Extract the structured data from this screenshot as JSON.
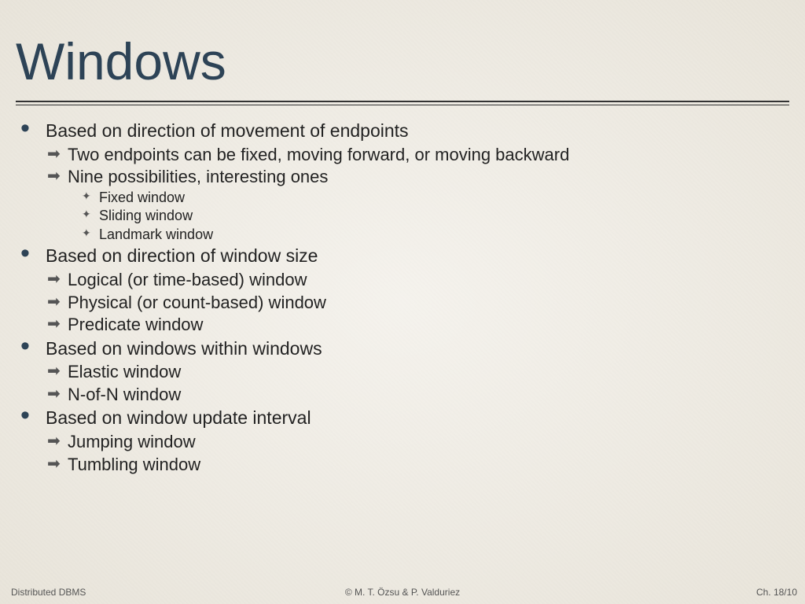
{
  "title": "Windows",
  "sections": [
    {
      "heading": "Based on direction of movement of endpoints",
      "sub": [
        "Two endpoints can be fixed, moving forward, or moving backward",
        "Nine possibilities, interesting ones"
      ],
      "subsub": [
        "Fixed window",
        "Sliding window",
        "Landmark window"
      ]
    },
    {
      "heading": "Based on direction of window size",
      "sub": [
        "Logical (or time-based) window",
        "Physical (or count-based) window",
        "Predicate window"
      ]
    },
    {
      "heading": "Based on windows within windows",
      "sub": [
        "Elastic window",
        "N-of-N window"
      ]
    },
    {
      "heading": "Based on window update interval",
      "sub": [
        "Jumping window",
        "Tumbling window"
      ]
    }
  ],
  "footer": {
    "left": "Distributed DBMS",
    "center": "© M. T. Özsu & P. Valduriez",
    "right": "Ch. 18/10"
  }
}
